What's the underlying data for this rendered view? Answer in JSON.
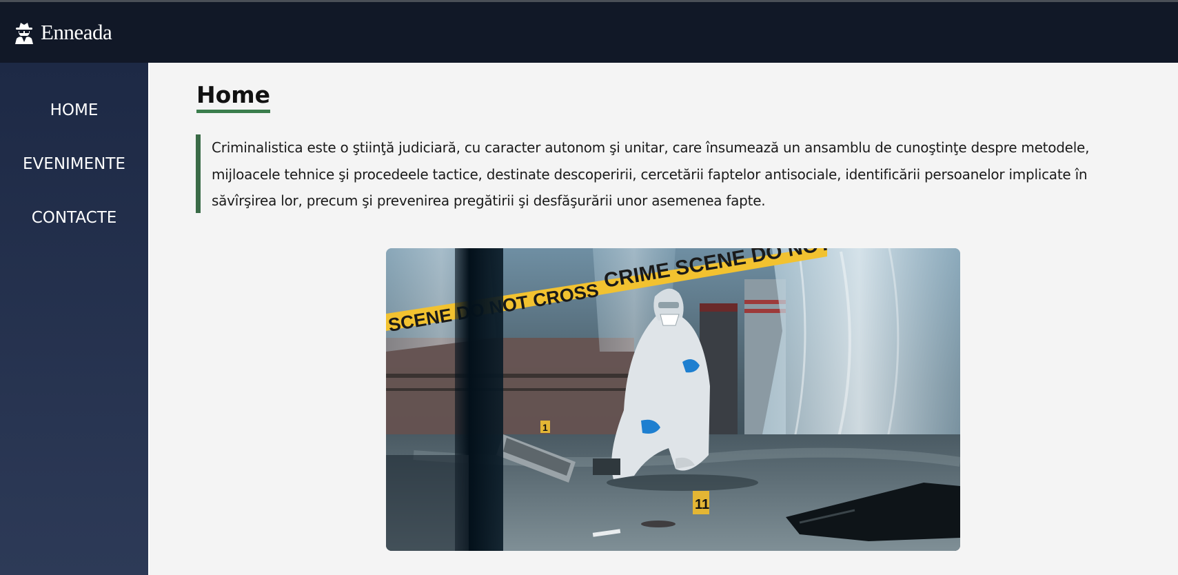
{
  "header": {
    "brand_name": "Enneada",
    "logo_icon": "spy-icon"
  },
  "sidebar": {
    "items": [
      {
        "label": "HOME"
      },
      {
        "label": "EVENIMENTE"
      },
      {
        "label": "CONTACTE"
      }
    ]
  },
  "main": {
    "title": "Home",
    "intro_text": "Criminalistica este o ştiinţă judiciară, cu caracter autonom şi unitar, care însumează un ansamblu de cunoştinţe despre metodele, mijloacele tehnice şi procedeele tactice, destinate descoperirii, cercetării faptelor antisociale, identificării persoanelor implicate în săvîrşirea lor, precum şi prevenirea pregătirii şi desfăşurării unor asemenea fapte.",
    "hero_image": {
      "tape_text": "CRIME SCENE DO NOT CROSS",
      "marker_labels": [
        "1",
        "11"
      ]
    }
  },
  "colors": {
    "header_bg": "#111827",
    "sidebar_top": "#1d2945",
    "sidebar_bottom": "#2d3a57",
    "accent_green": "#3a7d4c",
    "page_bg": "#f4f4f4",
    "tape_yellow": "#f2c230"
  }
}
